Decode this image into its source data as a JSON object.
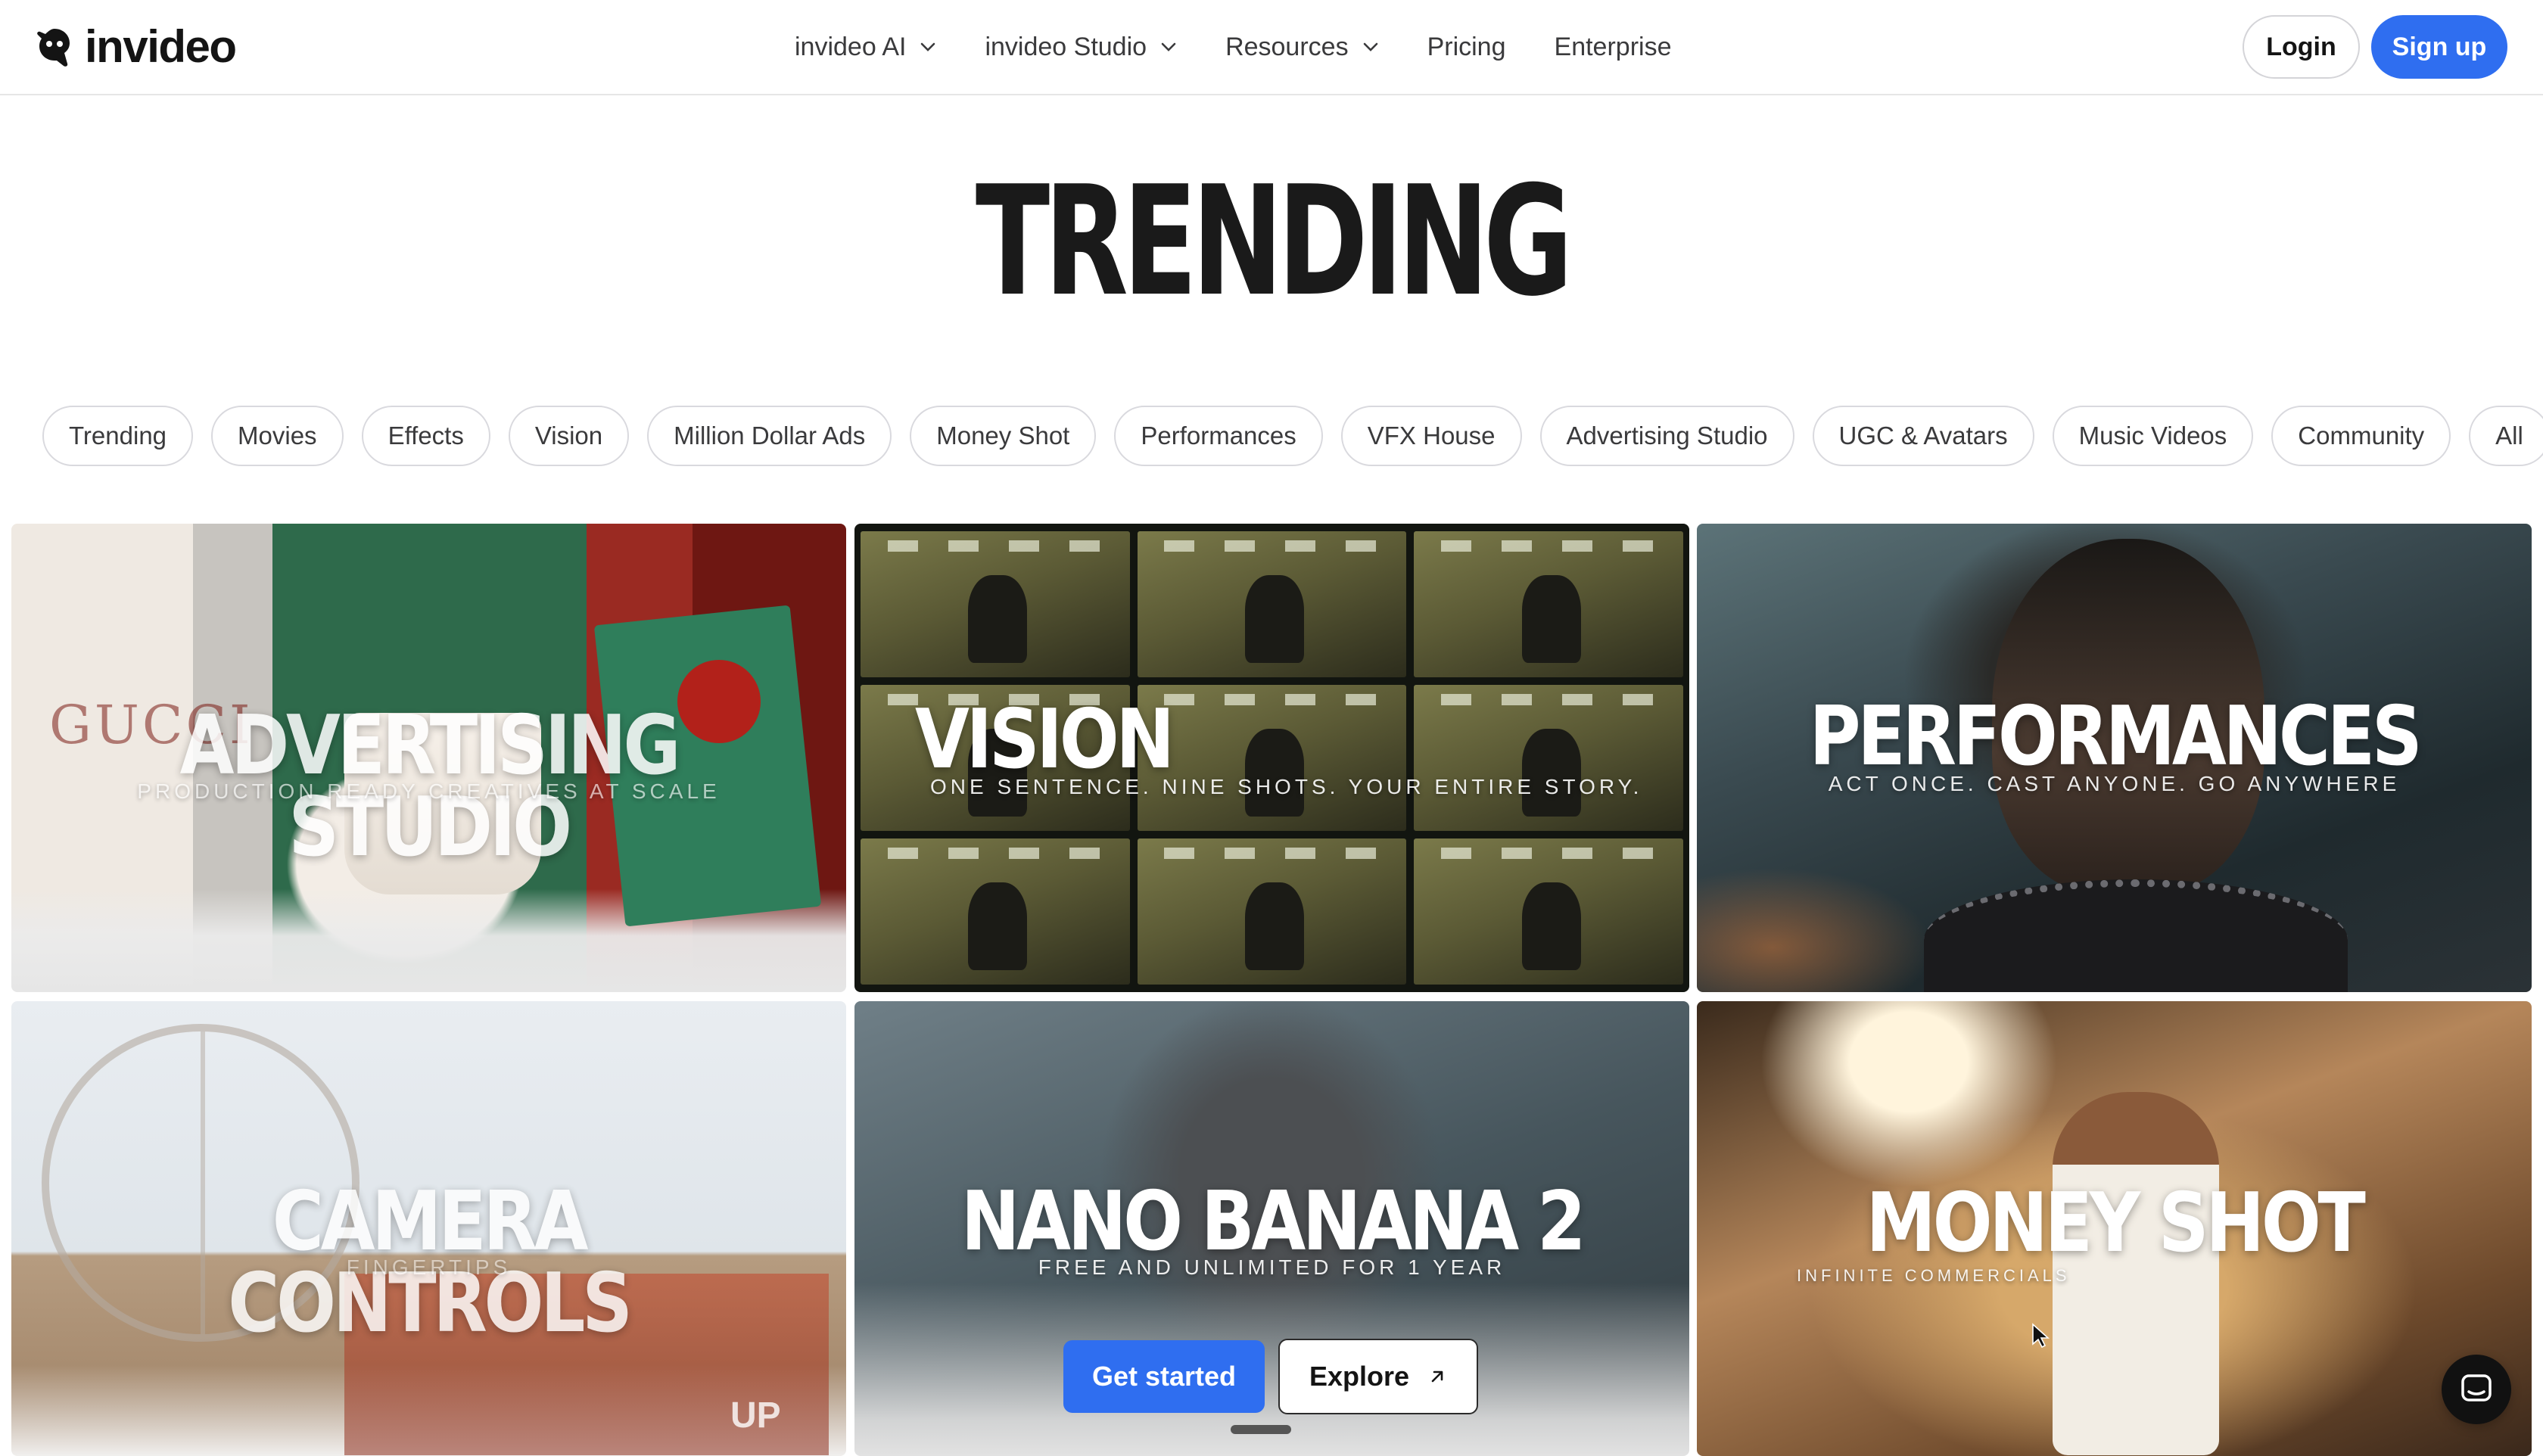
{
  "header": {
    "logo_text": "invideo",
    "nav": [
      {
        "label": "invideo AI",
        "dropdown": true
      },
      {
        "label": "invideo Studio",
        "dropdown": true
      },
      {
        "label": "Resources",
        "dropdown": true
      },
      {
        "label": "Pricing",
        "dropdown": false
      },
      {
        "label": "Enterprise",
        "dropdown": false
      }
    ],
    "login_label": "Login",
    "signup_label": "Sign up"
  },
  "hero": {
    "title": "TRENDING"
  },
  "chips": [
    "Trending",
    "Movies",
    "Effects",
    "Vision",
    "Million Dollar Ads",
    "Money Shot",
    "Performances",
    "VFX House",
    "Advertising Studio",
    "UGC & Avatars",
    "Music Videos",
    "Community",
    "All"
  ],
  "cards": [
    {
      "title": "ADVERTISING STUDIO",
      "subtitle": "PRODUCTION READY CREATIVES AT SCALE",
      "brand_text": "GUCCI"
    },
    {
      "title": "VISION",
      "subtitle": "ONE SENTENCE. NINE SHOTS. YOUR ENTIRE STORY."
    },
    {
      "title": "PERFORMANCES",
      "subtitle": "ACT ONCE. CAST ANYONE. GO ANYWHERE"
    },
    {
      "title": "CAMERA CONTROLS",
      "subtitle": "FINGERTIPS",
      "corner_text": "UP"
    },
    {
      "title": "NANO BANANA 2",
      "subtitle": "FREE AND UNLIMITED FOR 1 YEAR",
      "get_started_label": "Get started",
      "explore_label": "Explore"
    },
    {
      "title": "MONEY SHOT",
      "subtitle": "INFINITE COMMERCIALS"
    }
  ],
  "colors": {
    "accent": "#2f6ef0",
    "text": "#1c1c1e",
    "chip_border": "#d9d9de"
  },
  "icons": {
    "logo": "invideo-logo-icon",
    "chevron": "chevron-down-icon",
    "external": "arrow-up-right-icon",
    "chat": "chat-icon"
  }
}
